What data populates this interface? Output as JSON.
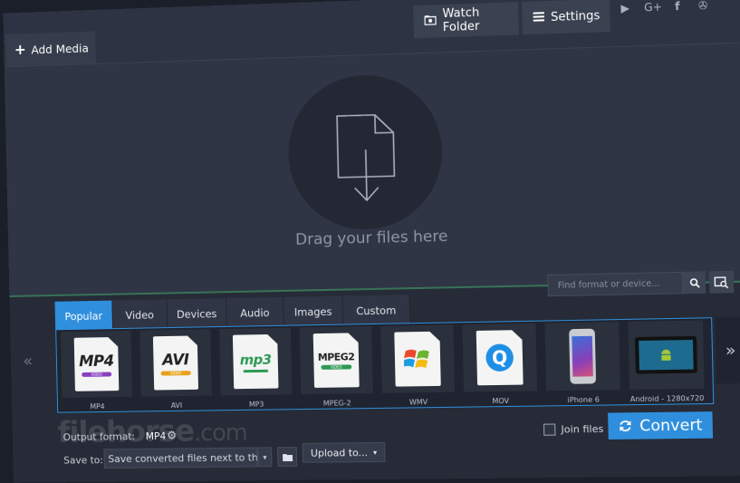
{
  "toolbar": {
    "add_media_label": "Add Media",
    "watch_folder_label": "Watch Folder",
    "settings_label": "Settings",
    "social_icons": [
      "youtube-icon",
      "google-plus-icon",
      "facebook-icon",
      "vk-icon"
    ]
  },
  "social": {
    "youtube": "▶",
    "google_plus": "G+",
    "facebook": "f",
    "vk": "✇"
  },
  "dropzone": {
    "text": "Drag your files here"
  },
  "format_tabs": [
    "Popular",
    "Video",
    "Devices",
    "Audio",
    "Images",
    "Custom"
  ],
  "active_tab": "Popular",
  "search": {
    "placeholder": "Find format or device..."
  },
  "navigation": {
    "prev": "«",
    "next": "»"
  },
  "formats": [
    {
      "label": "MP4",
      "icon_text": "MP4",
      "sub": "VIDEO"
    },
    {
      "label": "AVI",
      "icon_text": "AVI",
      "sub": "VIDEO"
    },
    {
      "label": "MP3",
      "icon_text": "mp3",
      "sub": ""
    },
    {
      "label": "MPEG-2",
      "icon_text": "MPEG2",
      "sub": "VIDEO"
    },
    {
      "label": "WMV",
      "icon_text": "",
      "sub": ""
    },
    {
      "label": "MOV",
      "icon_text": "Q",
      "sub": ""
    },
    {
      "label": "iPhone 6",
      "icon_text": "",
      "sub": ""
    },
    {
      "label": "Android - 1280x720",
      "icon_text": "",
      "sub": ""
    }
  ],
  "output": {
    "label": "Output format:",
    "value": "MP4"
  },
  "save": {
    "label": "Save to:",
    "path": "Save converted files next to the o",
    "dropdown": "▾",
    "upload_label": "Upload to...",
    "upload_arrow": "▾"
  },
  "join_files_label": "Join files",
  "convert_label": "Convert",
  "watermark": {
    "brand": "filehorse",
    "tld": ".com"
  },
  "colors": {
    "accent": "#2f8fdd",
    "background": "#2b3140",
    "divider": "#3e8f5f"
  }
}
